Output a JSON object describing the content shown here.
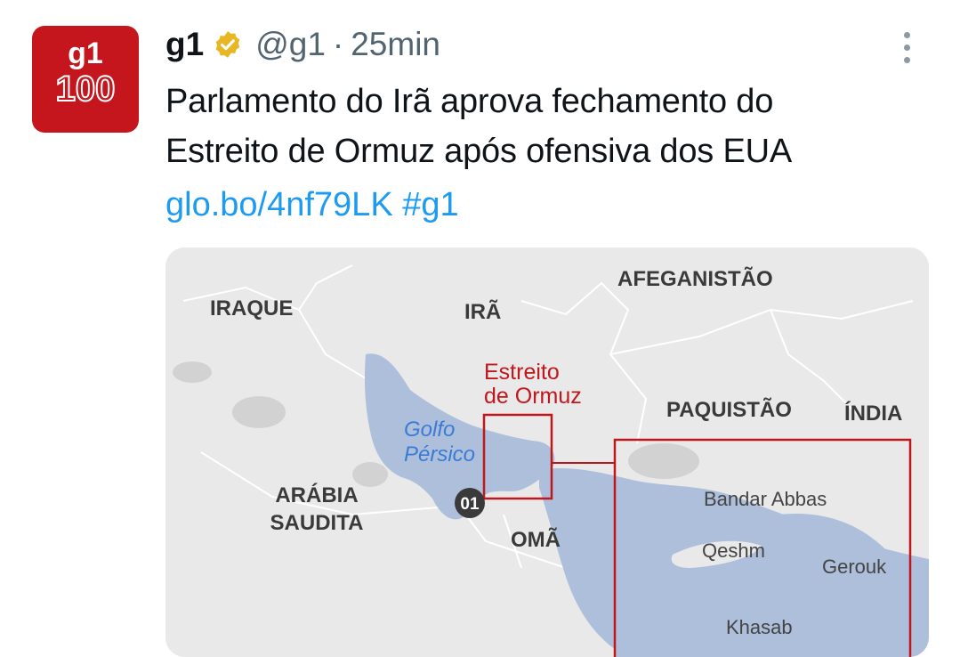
{
  "tweet": {
    "author_name": "g1",
    "handle": "@g1",
    "separator": "·",
    "time": "25min",
    "text_lines": [
      "Parlamento do Irã aprova fechamento do",
      "Estreito de Ormuz após ofensiva dos EUA"
    ],
    "link": "glo.bo/4nf79LK",
    "hashtag": "#g1"
  },
  "avatar": {
    "logo_top": "g1",
    "logo_bottom": "100",
    "bg_color": "#c4161c"
  },
  "icons": {
    "verified": "verified-badge-icon",
    "more": "more-options-icon"
  },
  "colors": {
    "link": "#1d9bf0",
    "secondary": "#536471",
    "map_water": "#aebfdb",
    "map_land": "#e8e8e8",
    "map_red": "#c0171c"
  },
  "map": {
    "countries": {
      "iraque": "IRAQUE",
      "ira": "IRÃ",
      "afeganistao": "AFEGANISTÃO",
      "paquistao": "PAQUISTÃO",
      "india": "ÍNDIA",
      "arabia_line1": "ARÁBIA",
      "arabia_line2": "SAUDITA",
      "oma": "OMÃ"
    },
    "strait_line1": "Estreito",
    "strait_line2": "de Ormuz",
    "gulf_line1": "Golfo",
    "gulf_line2": "Pérsico",
    "marker": "01",
    "cities": {
      "bandar_abbas": "Bandar Abbas",
      "qeshm": "Qeshm",
      "gerouk": "Gerouk",
      "khasab": "Khasab"
    }
  }
}
